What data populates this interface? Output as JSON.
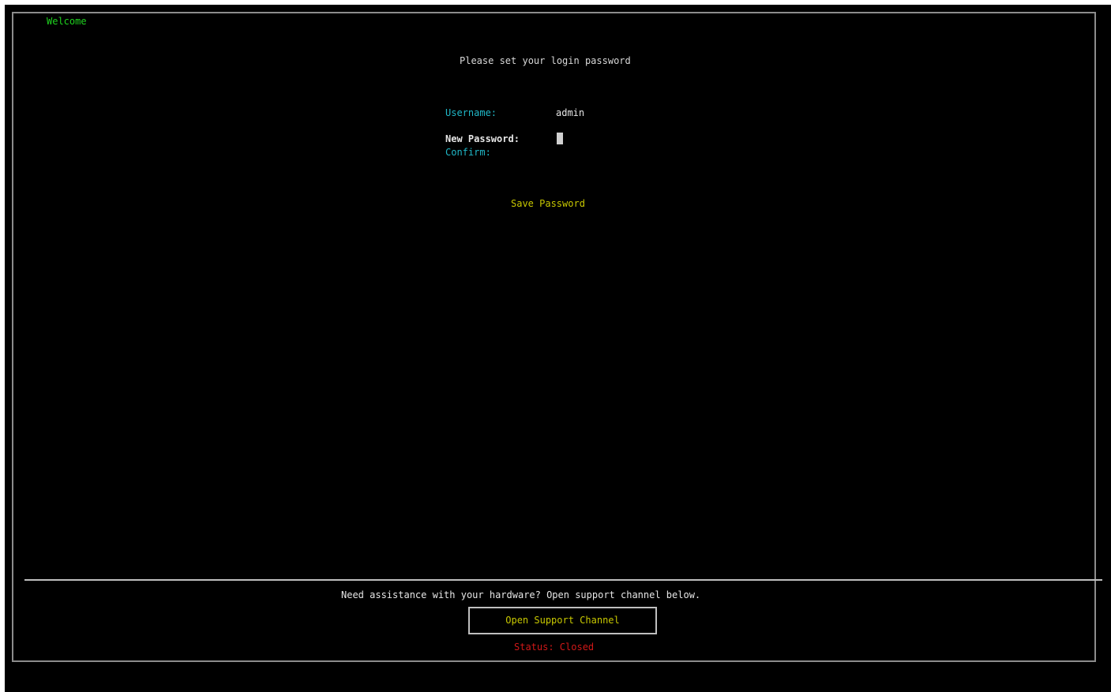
{
  "frame": {
    "title": "Welcome"
  },
  "form": {
    "prompt": "Please set your login password",
    "username_label": "Username:",
    "username_value": "admin",
    "new_password_label": "New Password:",
    "confirm_label": "Confirm:",
    "save_button_label": "Save Password"
  },
  "support": {
    "help_text": "Need assistance with your hardware? Open support channel below.",
    "button_label": "Open Support Channel",
    "status_text": "Status: Closed"
  },
  "colors": {
    "background": "#000000",
    "title_green": "#1fd21f",
    "label_cyan": "#20b8c8",
    "button_yellow": "#c8c800",
    "status_red": "#d01818",
    "border_gray": "#bfbfbf"
  }
}
